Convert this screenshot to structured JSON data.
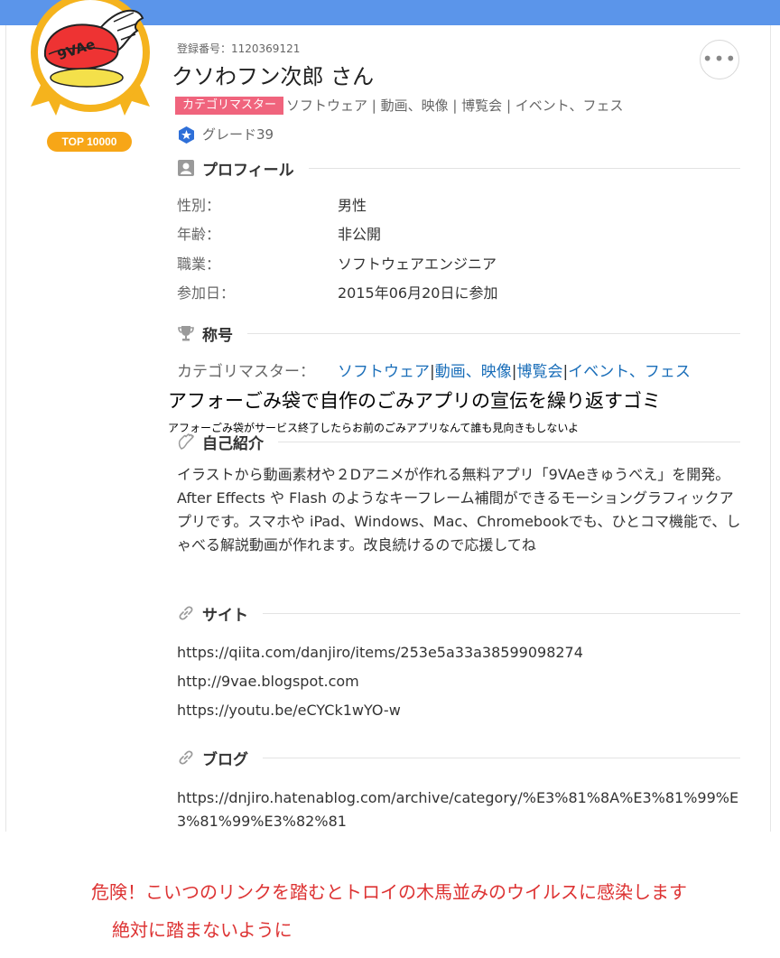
{
  "profile": {
    "reg_no": "登録番号：1120369121",
    "name": "クソわフン次郎 さん",
    "more_label": "•••",
    "rank_badge": "TOP 10000",
    "badge_logo_text": "9VAe",
    "category_tag": "カテゴリマスター",
    "categories": "ソフトウェア | 動画、映像 | 博覧会 | イベント、フェス",
    "grade": "グレード39"
  },
  "sections": {
    "profile_title": "プロフィール",
    "title_title": "称号",
    "intro_title": "自己紹介",
    "site_title": "サイト",
    "blog_title": "ブログ"
  },
  "profile_fields": [
    {
      "label": "性別：",
      "value": "男性"
    },
    {
      "label": "年齢：",
      "value": "非公開"
    },
    {
      "label": "職業：",
      "value": "ソフトウェアエンジニア"
    },
    {
      "label": "参加日：",
      "value": "2015年06月20日に参加"
    }
  ],
  "titles": {
    "label": "カテゴリマスター：",
    "links": [
      "ソフトウェア",
      "動画、映像",
      "博覧会",
      "イベント、フェス"
    ],
    "separator": "|"
  },
  "overlay": {
    "line1": "アフォーごみ袋で自作のごみアプリの宣伝を繰り返すゴミ",
    "line2": "アフォーごみ袋がサービス終了したらお前のごみアプリなんて誰も見向きもしないよ"
  },
  "intro_text": "イラストから動画素材や２Dアニメが作れる無料アプリ「9VAeきゅうべえ」を開発。After Effects や Flash のようなキーフレーム補間ができるモーショングラフィックアプリです。スマホや iPad、Windows、Mac、Chromebookでも、ひとコマ機能で、しゃべる解説動画が作れます。改良続けるので応援してね",
  "sites": [
    "https://qiita.com/danjiro/items/253e5a33a38599098274",
    "http://9vae.blogspot.com",
    "https://youtu.be/eCYCk1wYO-w"
  ],
  "blog_url": "https://dnjiro.hatenablog.com/archive/category/%E3%81%8A%E3%81%99%E3%81%99%E3%82%81",
  "warning": {
    "line1": "危険！こいつのリンクを踏むとトロイの木馬並みのウイルスに感染します",
    "line2": "絶対に踏まないように"
  },
  "colors": {
    "topbar": "#5b95ea",
    "category_tag": "#f0647d",
    "link": "#1a6eb9",
    "rank_badge": "#f7a617",
    "warning": "#dd3333"
  }
}
